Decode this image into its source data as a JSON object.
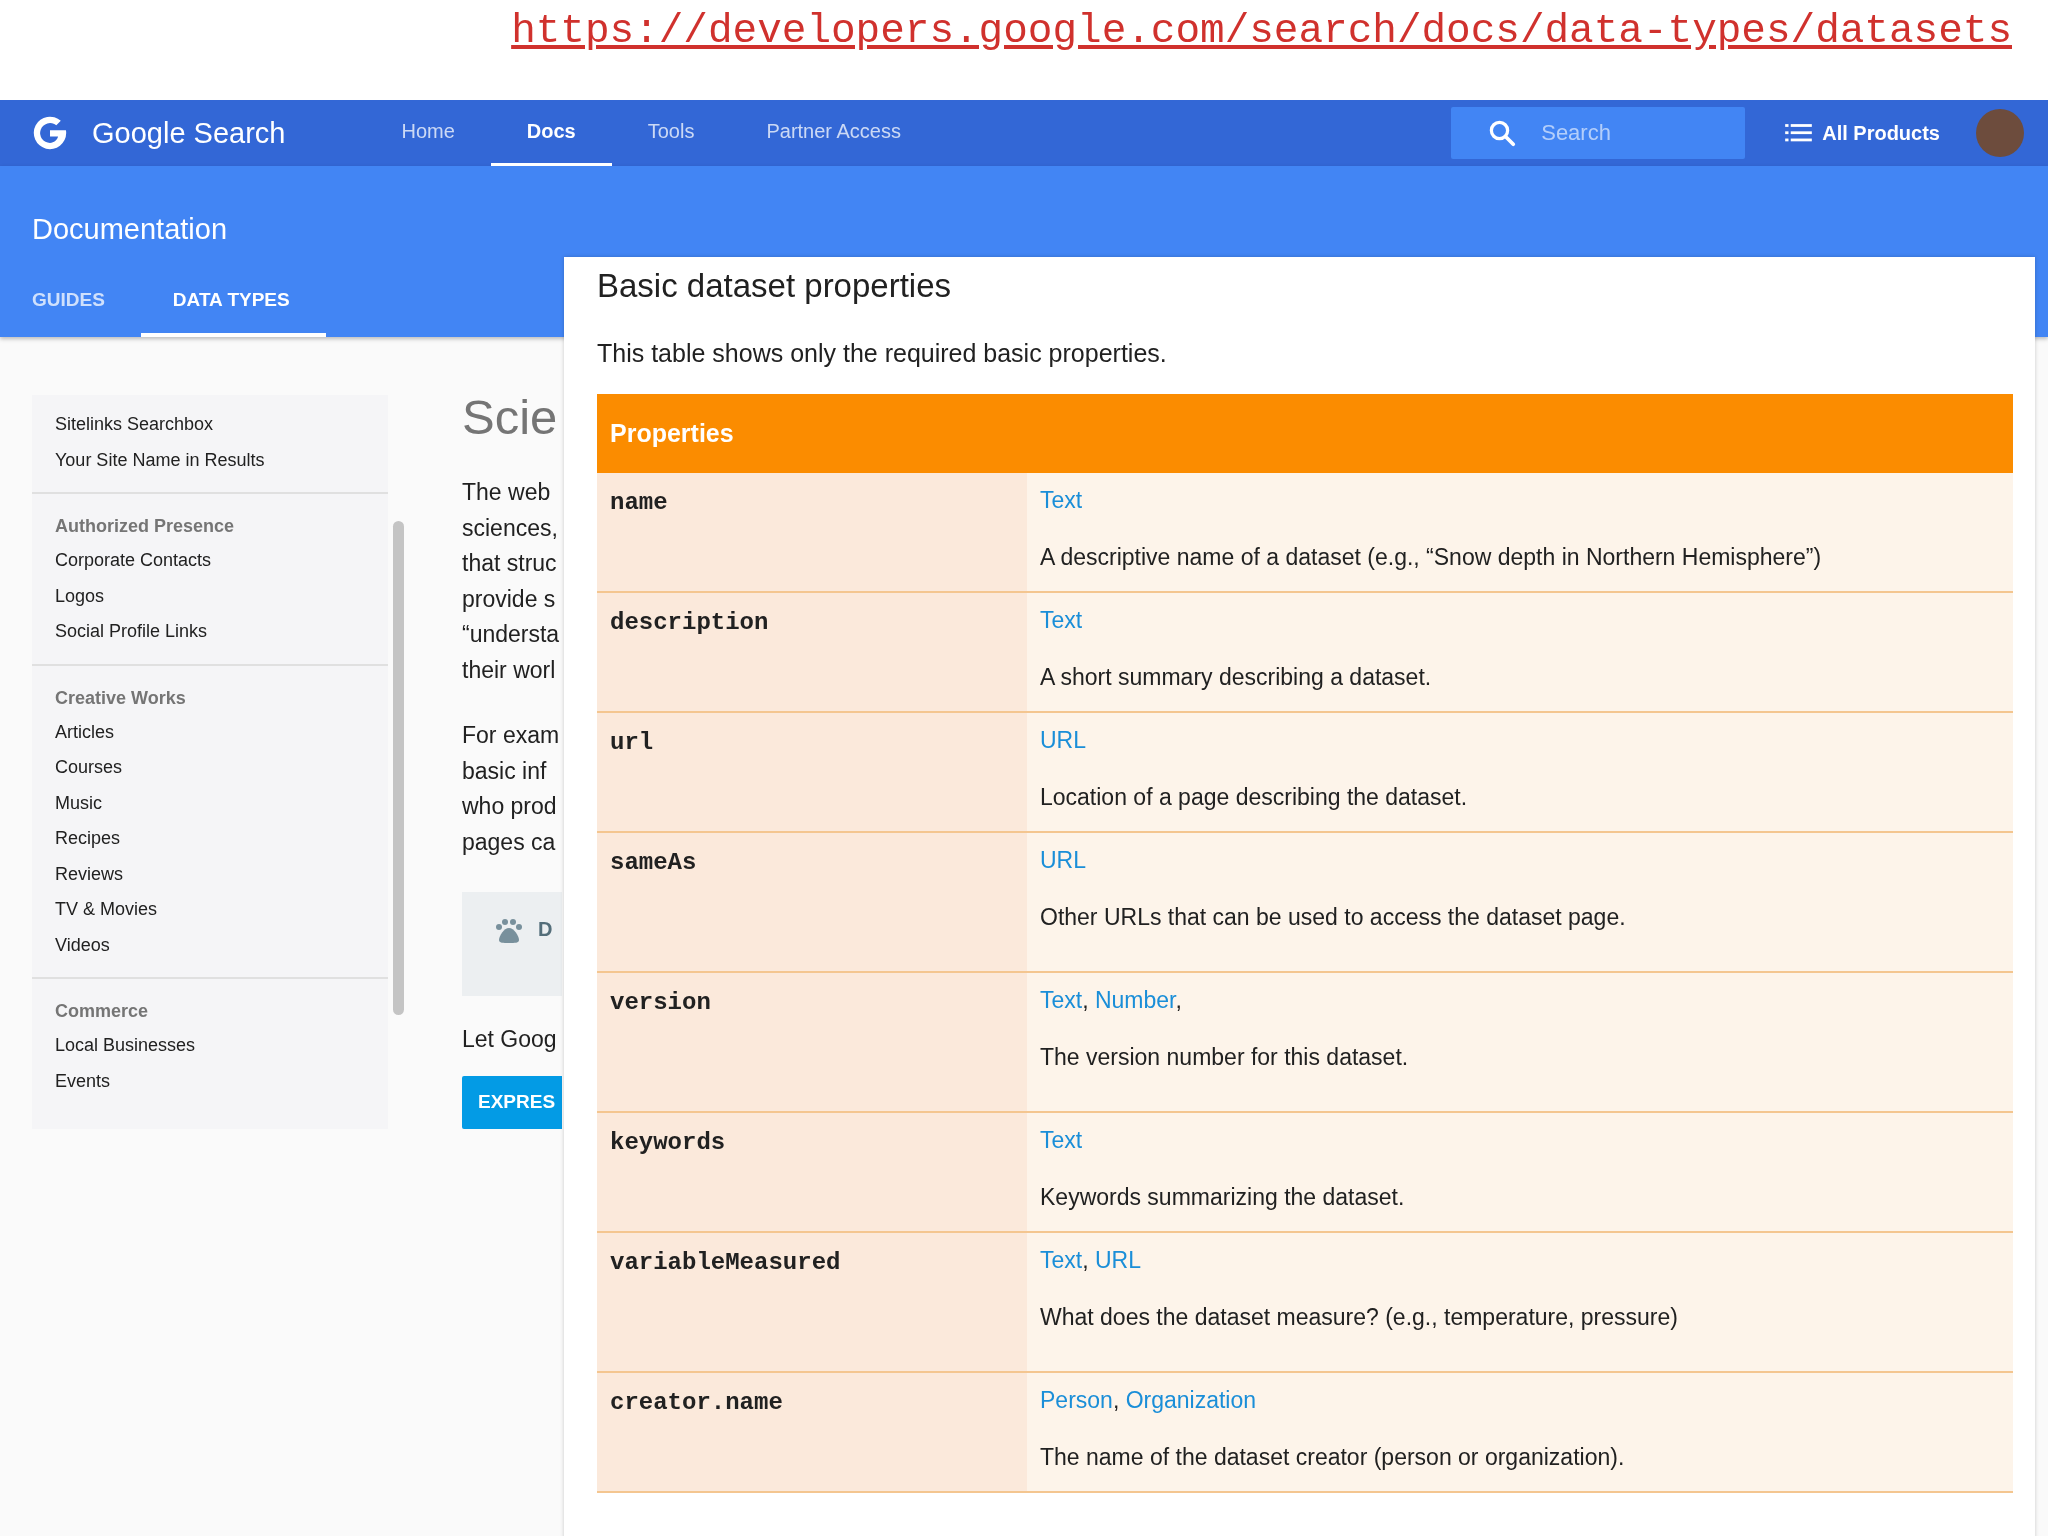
{
  "url": "https://developers.google.com/search/docs/data-types/datasets",
  "header": {
    "site_title": "Google Search",
    "nav": [
      {
        "label": "Home",
        "selected": false
      },
      {
        "label": "Docs",
        "selected": true
      },
      {
        "label": "Tools",
        "selected": false
      },
      {
        "label": "Partner Access",
        "selected": false
      }
    ],
    "search": {
      "placeholder": "Search"
    },
    "all_products": "All Products"
  },
  "banner": {
    "title": "Documentation",
    "tabs": [
      {
        "label": "GUIDES",
        "selected": false
      },
      {
        "label": "DATA TYPES",
        "selected": true
      }
    ]
  },
  "sidebar": {
    "sections": [
      {
        "items": [
          "Sitelinks Searchbox",
          "Your Site Name in Results"
        ]
      },
      {
        "heading": "Authorized Presence",
        "items": [
          "Corporate Contacts",
          "Logos",
          "Social Profile Links"
        ]
      },
      {
        "heading": "Creative Works",
        "items": [
          "Articles",
          "Courses",
          "Music",
          "Recipes",
          "Reviews",
          "TV & Movies",
          "Videos"
        ]
      },
      {
        "heading": "Commerce",
        "items": [
          "Local Businesses",
          "Events"
        ]
      }
    ]
  },
  "content": {
    "heading": "Scie",
    "paragraphs": [
      [
        "The web",
        "sciences,",
        "that struc",
        "provide s",
        "“understa",
        "their worl"
      ],
      [
        "For exam",
        "basic inf",
        "who prod",
        "pages ca"
      ]
    ],
    "callout": "D",
    "closing": "Let Goog",
    "button": "EXPRES"
  },
  "panel": {
    "title": "Basic dataset properties",
    "intro": "This table shows only the required basic properties.",
    "table": {
      "header": "Properties",
      "rows": [
        {
          "name": "name",
          "types": [
            {
              "label": "Text"
            }
          ],
          "description": "A descriptive name of a dataset (e.g., “Snow depth in Northern Hemisphere”)"
        },
        {
          "name": "description",
          "types": [
            {
              "label": "Text"
            }
          ],
          "description": "A short summary describing a dataset."
        },
        {
          "name": "url",
          "types": [
            {
              "label": "URL"
            }
          ],
          "description": "Location of a page describing the dataset."
        },
        {
          "name": "sameAs",
          "types": [
            {
              "label": "URL"
            }
          ],
          "description": "Other URLs that can be used to access the dataset page."
        },
        {
          "name": "version",
          "types": [
            {
              "label": "Text",
              "after": ","
            },
            {
              "label": "Number",
              "after": ","
            }
          ],
          "description": "The version number for this dataset."
        },
        {
          "name": "keywords",
          "types": [
            {
              "label": "Text"
            }
          ],
          "description": "Keywords summarizing the dataset."
        },
        {
          "name": "variableMeasured",
          "types": [
            {
              "label": "Text",
              "after": ","
            },
            {
              "label": "URL"
            }
          ],
          "description": "What does the dataset measure? (e.g., temperature, pressure)"
        },
        {
          "name": "creator.name",
          "types": [
            {
              "label": "Person",
              "after": ","
            },
            {
              "label": "Organization"
            }
          ],
          "description": "The name of the dataset creator (person or organization)."
        }
      ]
    }
  }
}
